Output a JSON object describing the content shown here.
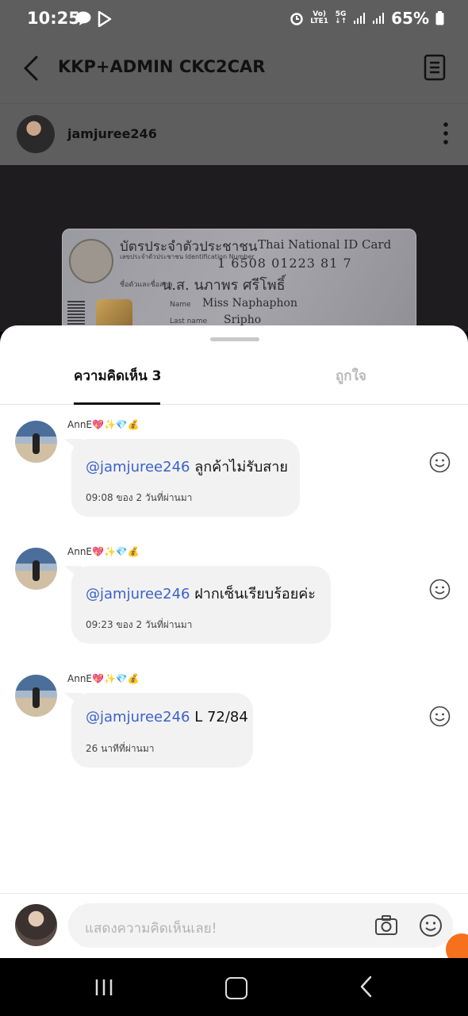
{
  "status_bar": {
    "time": "10:25",
    "battery": "65%",
    "lte_label": "LTE1",
    "vo_label": "Vo)",
    "net": "5G"
  },
  "chat": {
    "title": "KKP+ADMIN CKC2CAR"
  },
  "post": {
    "author": "jamjuree246",
    "id_card": {
      "title_th": "บัตรประจำตัวประชาชน",
      "title_en": "Thai National ID Card",
      "number_label": "เลขประจำตัวประชาชน Identification Number",
      "number": "1 6508 01223 81 7",
      "name_label": "ชื่อตัวและชื่อสกุล",
      "name_th": "น.ส. นภาพร ศรีโพธิ์",
      "name_en_label": "Name",
      "name_en": "Miss Naphaphon",
      "last_name_label": "Last name",
      "last_name": "Sripho"
    }
  },
  "sheet": {
    "tabs": [
      {
        "label": "ความคิดเห็น 3",
        "active": true
      },
      {
        "label": "ถูกใจ",
        "active": false
      }
    ]
  },
  "comments": [
    {
      "author": "AnnE",
      "emojis": "💖✨💎💰",
      "mention": "@jamjuree246",
      "text": " ลูกค้าไม่รับสาย",
      "time": "09:08 ของ 2 วันที่ผ่านมา"
    },
    {
      "author": "AnnE",
      "emojis": "💖✨💎💰",
      "mention": "@jamjuree246",
      "text": " ฝากเซ็นเรียบร้อยค่ะ",
      "time": "09:23 ของ 2 วันที่ผ่านมา"
    },
    {
      "author": "AnnE",
      "emojis": "💖✨💎💰",
      "mention": "@jamjuree246",
      "text": " L 72/84",
      "time": "26 นาทีที่ผ่านมา"
    }
  ],
  "composer": {
    "placeholder": "แสดงความคิดเห็นเลย!"
  },
  "colors": {
    "mention": "#3b62c9",
    "accent_badge": "#f5711d",
    "overlay": "#5e5e5e"
  }
}
